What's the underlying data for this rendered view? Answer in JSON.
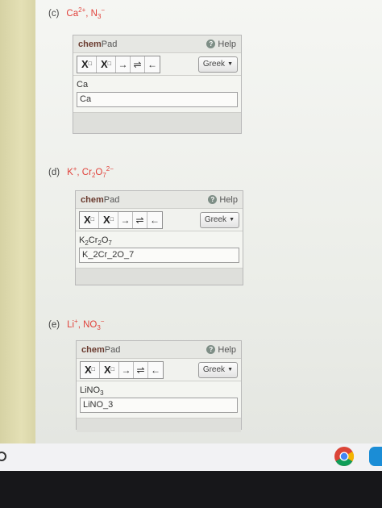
{
  "questions": [
    {
      "label": "(c)",
      "ions": [
        {
          "base": "Ca",
          "charge": "2+",
          "sub": ""
        },
        {
          "base": "N",
          "charge": "−",
          "sub": "3"
        }
      ],
      "pad": {
        "brand_bold": "chem",
        "brand_rest": "Pad",
        "help": "Help",
        "greek": "Greek",
        "rendered": "Ca",
        "input_value": "Ca"
      }
    },
    {
      "label": "(d)",
      "pad": {
        "brand_bold": "chem",
        "brand_rest": "Pad",
        "help": "Help",
        "greek": "Greek",
        "input_value": "K_2Cr_2O_7"
      }
    },
    {
      "label": "(e)",
      "pad": {
        "brand_bold": "chem",
        "brand_rest": "Pad",
        "help": "Help",
        "greek": "Greek",
        "input_value": "LiNO_3"
      }
    }
  ],
  "formulas": {
    "d_ion1": "K",
    "d_ion1_charge": "+",
    "d_ion2_a": "Cr",
    "d_ion2_a_sub": "2",
    "d_ion2_b": "O",
    "d_ion2_b_sub": "7",
    "d_ion2_charge": "2−",
    "e_ion1": "Li",
    "e_ion1_charge": "+",
    "e_ion2": "NO",
    "e_ion2_sub": "3",
    "e_ion2_charge": "−",
    "d_render": [
      "K",
      "2",
      "Cr",
      "2",
      "O",
      "7"
    ],
    "e_render": [
      "LiNO",
      "3"
    ]
  },
  "toolbar": {
    "subscript_letter": "X",
    "subscript_mark": "□",
    "superscript_letter": "X",
    "superscript_mark": "□",
    "arrow": "→",
    "equilibrium": "⇌",
    "left_arrow": "←"
  },
  "icons": {
    "help": "?",
    "dropdown": "▼"
  },
  "colors": {
    "ion_formula": "#e0413a",
    "brand": "#6a3a2e"
  }
}
